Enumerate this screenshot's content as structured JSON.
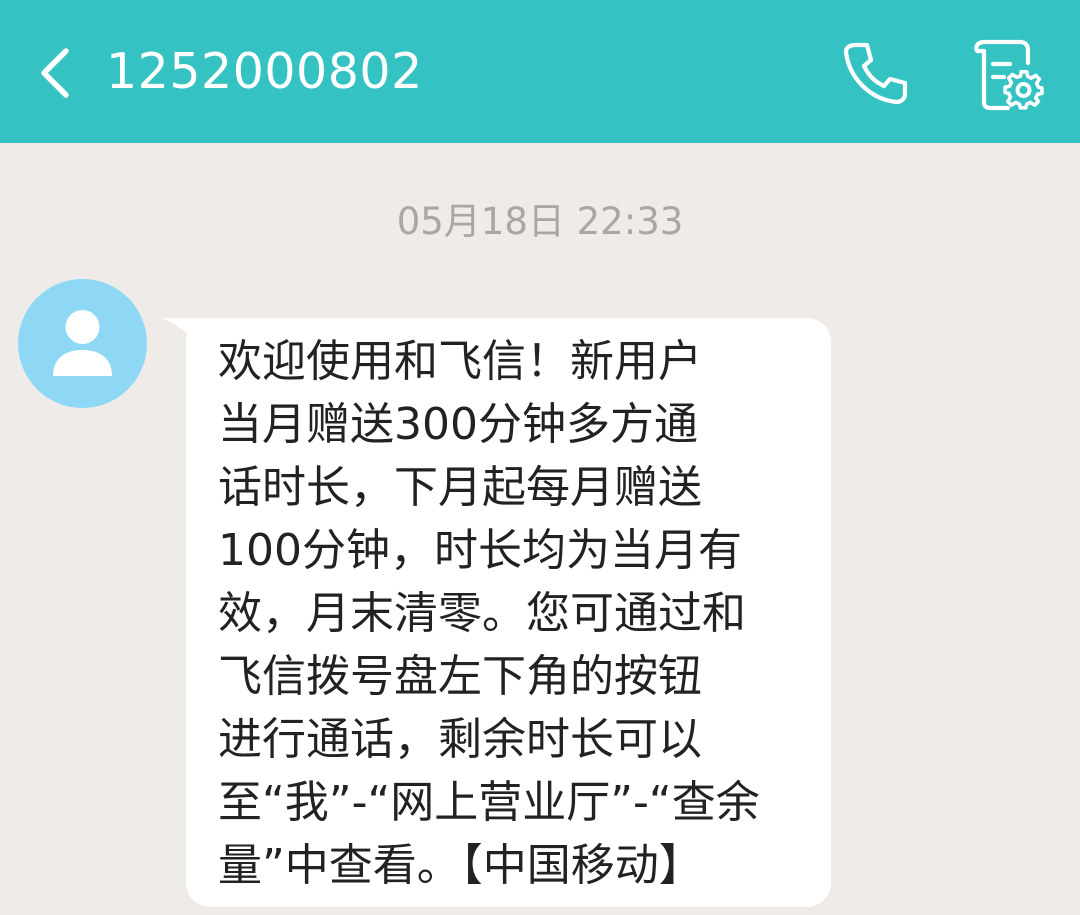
{
  "header": {
    "title": "1252000802",
    "back_icon": "chevron-left-icon",
    "call_icon": "phone-icon",
    "settings_icon": "chat-settings-icon",
    "background_color": "#35c2c2"
  },
  "conversation": {
    "timestamp": "05月18日 22:33",
    "messages": [
      {
        "sender_avatar_icon": "person-icon",
        "avatar_color": "#8ed8f6",
        "lines": [
          "欢迎使用和飞信！新用户",
          "当月赠送300分钟多方通",
          "话时长，下月起每月赠送",
          "100分钟，时长均为当月有",
          "效，月末清零。您可通过和",
          "飞信拨号盘左下角的按钮",
          "进行通话，剩余时长可以",
          "至“我”-“网上营业厅”-“查余",
          "量”中查看。【中国移动】"
        ]
      }
    ]
  }
}
